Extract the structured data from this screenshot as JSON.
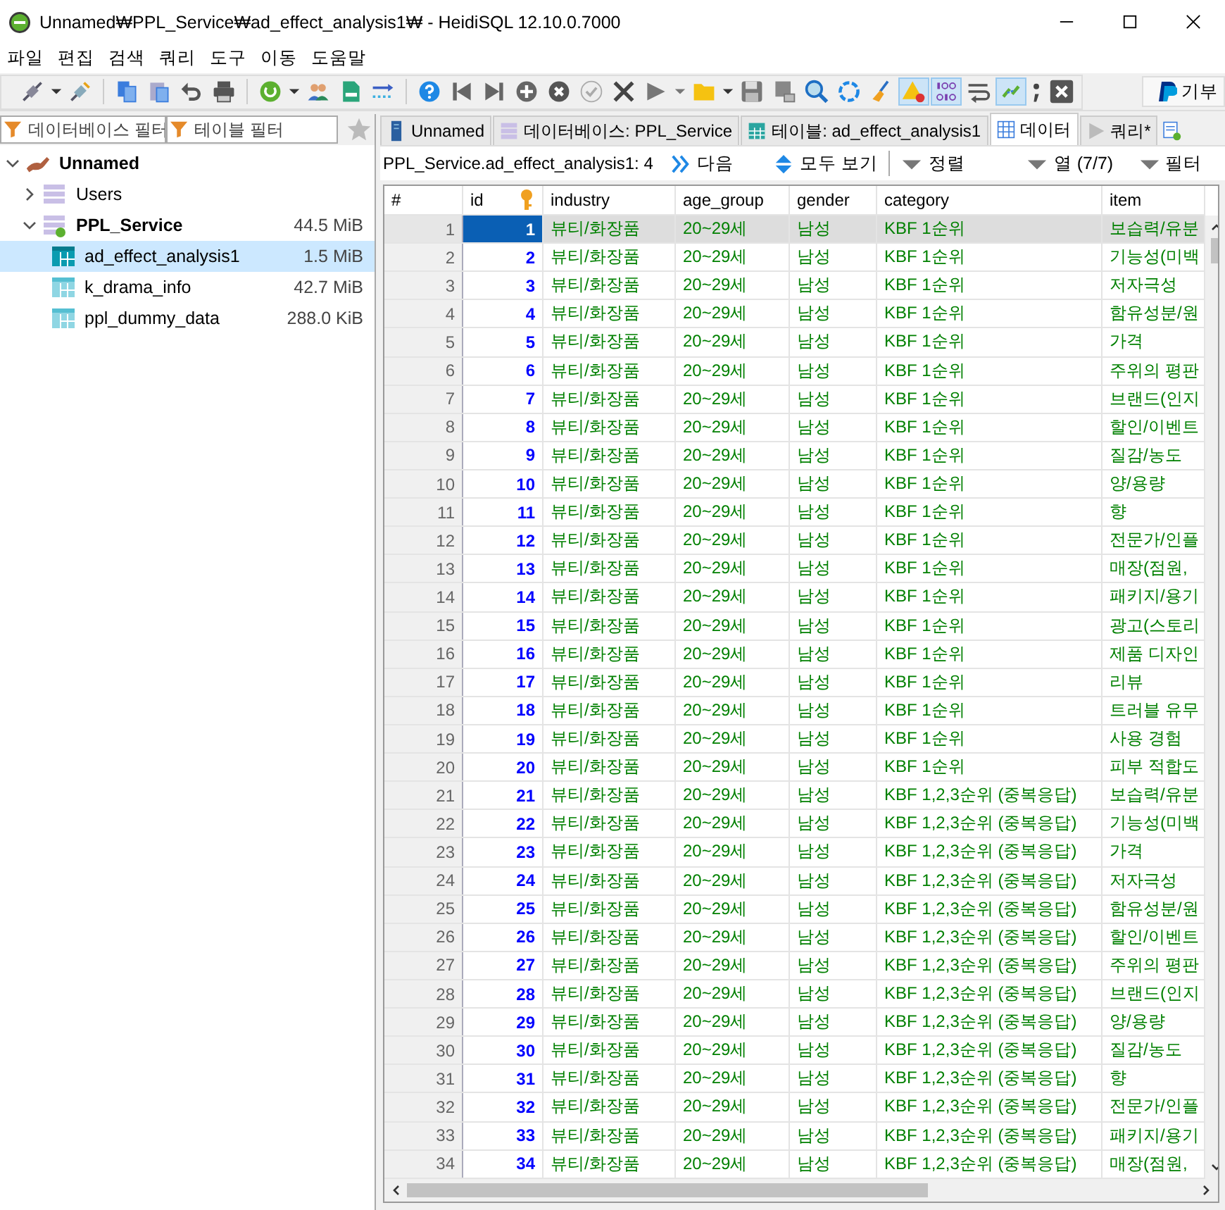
{
  "window": {
    "title": "Unnamed₩PPL_Service₩ad_effect_analysis1₩ - HeidiSQL 12.10.0.7000"
  },
  "menu": [
    "파일",
    "편집",
    "검색",
    "쿼리",
    "도구",
    "이동",
    "도움말"
  ],
  "toolbar": {
    "donate": "기부"
  },
  "filters": {
    "database": {
      "placeholder": "데이터베이스 필터"
    },
    "table": {
      "placeholder": "테이블 필터"
    }
  },
  "tree": [
    {
      "label": "Unnamed",
      "kind": "server",
      "expanded": true,
      "selected": false,
      "children": [
        {
          "label": "Users",
          "kind": "database",
          "expanded": false,
          "selected": false
        },
        {
          "label": "PPL_Service",
          "kind": "database",
          "expanded": true,
          "selected": false,
          "size": "44.5 MiB",
          "children": [
            {
              "label": "ad_effect_analysis1",
              "kind": "table",
              "selected": true,
              "size": "1.5 MiB"
            },
            {
              "label": "k_drama_info",
              "kind": "table",
              "selected": false,
              "size": "42.7 MiB"
            },
            {
              "label": "ppl_dummy_data",
              "kind": "table",
              "selected": false,
              "size": "288.0 KiB"
            }
          ]
        }
      ]
    }
  ],
  "tabs": [
    {
      "label": "Unnamed",
      "kind": "server",
      "selected": false
    },
    {
      "label": "데이터베이스: PPL_Service",
      "kind": "database",
      "selected": false
    },
    {
      "label": "테이블: ad_effect_analysis1",
      "kind": "table",
      "selected": false
    },
    {
      "label": "데이터",
      "kind": "data",
      "selected": true
    },
    {
      "label": "쿼리*",
      "kind": "query",
      "selected": false
    }
  ],
  "data_toolbar": {
    "label": "PPL_Service.ad_effect_analysis1: 4",
    "next": "다음",
    "show_all": "모두 보기",
    "sort": "정렬",
    "columns": "열 (7/7)",
    "filter": "필터"
  },
  "table": {
    "columns": [
      "#",
      "id",
      "industry",
      "age_group",
      "gender",
      "category",
      "item"
    ],
    "rows": [
      {
        "n": "1",
        "id": "1",
        "industry": "뷰티/화장품",
        "age_group": "20~29세",
        "gender": "남성",
        "category": "KBF 1순위",
        "item": "보습력/유분",
        "selected": true
      },
      {
        "n": "2",
        "id": "2",
        "industry": "뷰티/화장품",
        "age_group": "20~29세",
        "gender": "남성",
        "category": "KBF 1순위",
        "item": "기능성(미백",
        "selected": false
      },
      {
        "n": "3",
        "id": "3",
        "industry": "뷰티/화장품",
        "age_group": "20~29세",
        "gender": "남성",
        "category": "KBF 1순위",
        "item": "저자극성",
        "selected": false
      },
      {
        "n": "4",
        "id": "4",
        "industry": "뷰티/화장품",
        "age_group": "20~29세",
        "gender": "남성",
        "category": "KBF 1순위",
        "item": "함유성분/원",
        "selected": false
      },
      {
        "n": "5",
        "id": "5",
        "industry": "뷰티/화장품",
        "age_group": "20~29세",
        "gender": "남성",
        "category": "KBF 1순위",
        "item": "가격",
        "selected": false
      },
      {
        "n": "6",
        "id": "6",
        "industry": "뷰티/화장품",
        "age_group": "20~29세",
        "gender": "남성",
        "category": "KBF 1순위",
        "item": "주위의 평판",
        "selected": false
      },
      {
        "n": "7",
        "id": "7",
        "industry": "뷰티/화장품",
        "age_group": "20~29세",
        "gender": "남성",
        "category": "KBF 1순위",
        "item": "브랜드(인지",
        "selected": false
      },
      {
        "n": "8",
        "id": "8",
        "industry": "뷰티/화장품",
        "age_group": "20~29세",
        "gender": "남성",
        "category": "KBF 1순위",
        "item": "할인/이벤트",
        "selected": false
      },
      {
        "n": "9",
        "id": "9",
        "industry": "뷰티/화장품",
        "age_group": "20~29세",
        "gender": "남성",
        "category": "KBF 1순위",
        "item": "질감/농도",
        "selected": false
      },
      {
        "n": "10",
        "id": "10",
        "industry": "뷰티/화장품",
        "age_group": "20~29세",
        "gender": "남성",
        "category": "KBF 1순위",
        "item": "양/용량",
        "selected": false
      },
      {
        "n": "11",
        "id": "11",
        "industry": "뷰티/화장품",
        "age_group": "20~29세",
        "gender": "남성",
        "category": "KBF 1순위",
        "item": "향",
        "selected": false
      },
      {
        "n": "12",
        "id": "12",
        "industry": "뷰티/화장품",
        "age_group": "20~29세",
        "gender": "남성",
        "category": "KBF 1순위",
        "item": "전문가/인플",
        "selected": false
      },
      {
        "n": "13",
        "id": "13",
        "industry": "뷰티/화장품",
        "age_group": "20~29세",
        "gender": "남성",
        "category": "KBF 1순위",
        "item": "매장(점원,",
        "selected": false
      },
      {
        "n": "14",
        "id": "14",
        "industry": "뷰티/화장품",
        "age_group": "20~29세",
        "gender": "남성",
        "category": "KBF 1순위",
        "item": "패키지/용기",
        "selected": false
      },
      {
        "n": "15",
        "id": "15",
        "industry": "뷰티/화장품",
        "age_group": "20~29세",
        "gender": "남성",
        "category": "KBF 1순위",
        "item": "광고(스토리",
        "selected": false
      },
      {
        "n": "16",
        "id": "16",
        "industry": "뷰티/화장품",
        "age_group": "20~29세",
        "gender": "남성",
        "category": "KBF 1순위",
        "item": "제품 디자인",
        "selected": false
      },
      {
        "n": "17",
        "id": "17",
        "industry": "뷰티/화장품",
        "age_group": "20~29세",
        "gender": "남성",
        "category": "KBF 1순위",
        "item": "리뷰",
        "selected": false
      },
      {
        "n": "18",
        "id": "18",
        "industry": "뷰티/화장품",
        "age_group": "20~29세",
        "gender": "남성",
        "category": "KBF 1순위",
        "item": "트러블 유무",
        "selected": false
      },
      {
        "n": "19",
        "id": "19",
        "industry": "뷰티/화장품",
        "age_group": "20~29세",
        "gender": "남성",
        "category": "KBF 1순위",
        "item": "사용 경험",
        "selected": false
      },
      {
        "n": "20",
        "id": "20",
        "industry": "뷰티/화장품",
        "age_group": "20~29세",
        "gender": "남성",
        "category": "KBF 1순위",
        "item": "피부 적합도",
        "selected": false
      },
      {
        "n": "21",
        "id": "21",
        "industry": "뷰티/화장품",
        "age_group": "20~29세",
        "gender": "남성",
        "category": "KBF 1,2,3순위 (중복응답)",
        "item": "보습력/유분",
        "selected": false
      },
      {
        "n": "22",
        "id": "22",
        "industry": "뷰티/화장품",
        "age_group": "20~29세",
        "gender": "남성",
        "category": "KBF 1,2,3순위 (중복응답)",
        "item": "기능성(미백",
        "selected": false
      },
      {
        "n": "23",
        "id": "23",
        "industry": "뷰티/화장품",
        "age_group": "20~29세",
        "gender": "남성",
        "category": "KBF 1,2,3순위 (중복응답)",
        "item": "가격",
        "selected": false
      },
      {
        "n": "24",
        "id": "24",
        "industry": "뷰티/화장품",
        "age_group": "20~29세",
        "gender": "남성",
        "category": "KBF 1,2,3순위 (중복응답)",
        "item": "저자극성",
        "selected": false
      },
      {
        "n": "25",
        "id": "25",
        "industry": "뷰티/화장품",
        "age_group": "20~29세",
        "gender": "남성",
        "category": "KBF 1,2,3순위 (중복응답)",
        "item": "함유성분/원",
        "selected": false
      },
      {
        "n": "26",
        "id": "26",
        "industry": "뷰티/화장품",
        "age_group": "20~29세",
        "gender": "남성",
        "category": "KBF 1,2,3순위 (중복응답)",
        "item": "할인/이벤트",
        "selected": false
      },
      {
        "n": "27",
        "id": "27",
        "industry": "뷰티/화장품",
        "age_group": "20~29세",
        "gender": "남성",
        "category": "KBF 1,2,3순위 (중복응답)",
        "item": "주위의 평판",
        "selected": false
      },
      {
        "n": "28",
        "id": "28",
        "industry": "뷰티/화장품",
        "age_group": "20~29세",
        "gender": "남성",
        "category": "KBF 1,2,3순위 (중복응답)",
        "item": "브랜드(인지",
        "selected": false
      },
      {
        "n": "29",
        "id": "29",
        "industry": "뷰티/화장품",
        "age_group": "20~29세",
        "gender": "남성",
        "category": "KBF 1,2,3순위 (중복응답)",
        "item": "양/용량",
        "selected": false
      },
      {
        "n": "30",
        "id": "30",
        "industry": "뷰티/화장품",
        "age_group": "20~29세",
        "gender": "남성",
        "category": "KBF 1,2,3순위 (중복응답)",
        "item": "질감/농도",
        "selected": false
      },
      {
        "n": "31",
        "id": "31",
        "industry": "뷰티/화장품",
        "age_group": "20~29세",
        "gender": "남성",
        "category": "KBF 1,2,3순위 (중복응답)",
        "item": "향",
        "selected": false
      },
      {
        "n": "32",
        "id": "32",
        "industry": "뷰티/화장품",
        "age_group": "20~29세",
        "gender": "남성",
        "category": "KBF 1,2,3순위 (중복응답)",
        "item": "전문가/인플",
        "selected": false
      },
      {
        "n": "33",
        "id": "33",
        "industry": "뷰티/화장품",
        "age_group": "20~29세",
        "gender": "남성",
        "category": "KBF 1,2,3순위 (중복응답)",
        "item": "패키지/용기",
        "selected": false
      },
      {
        "n": "34",
        "id": "34",
        "industry": "뷰티/화장품",
        "age_group": "20~29세",
        "gender": "남성",
        "category": "KBF 1,2,3순위 (중복응답)",
        "item": "매장(점원,",
        "selected": false
      }
    ]
  }
}
